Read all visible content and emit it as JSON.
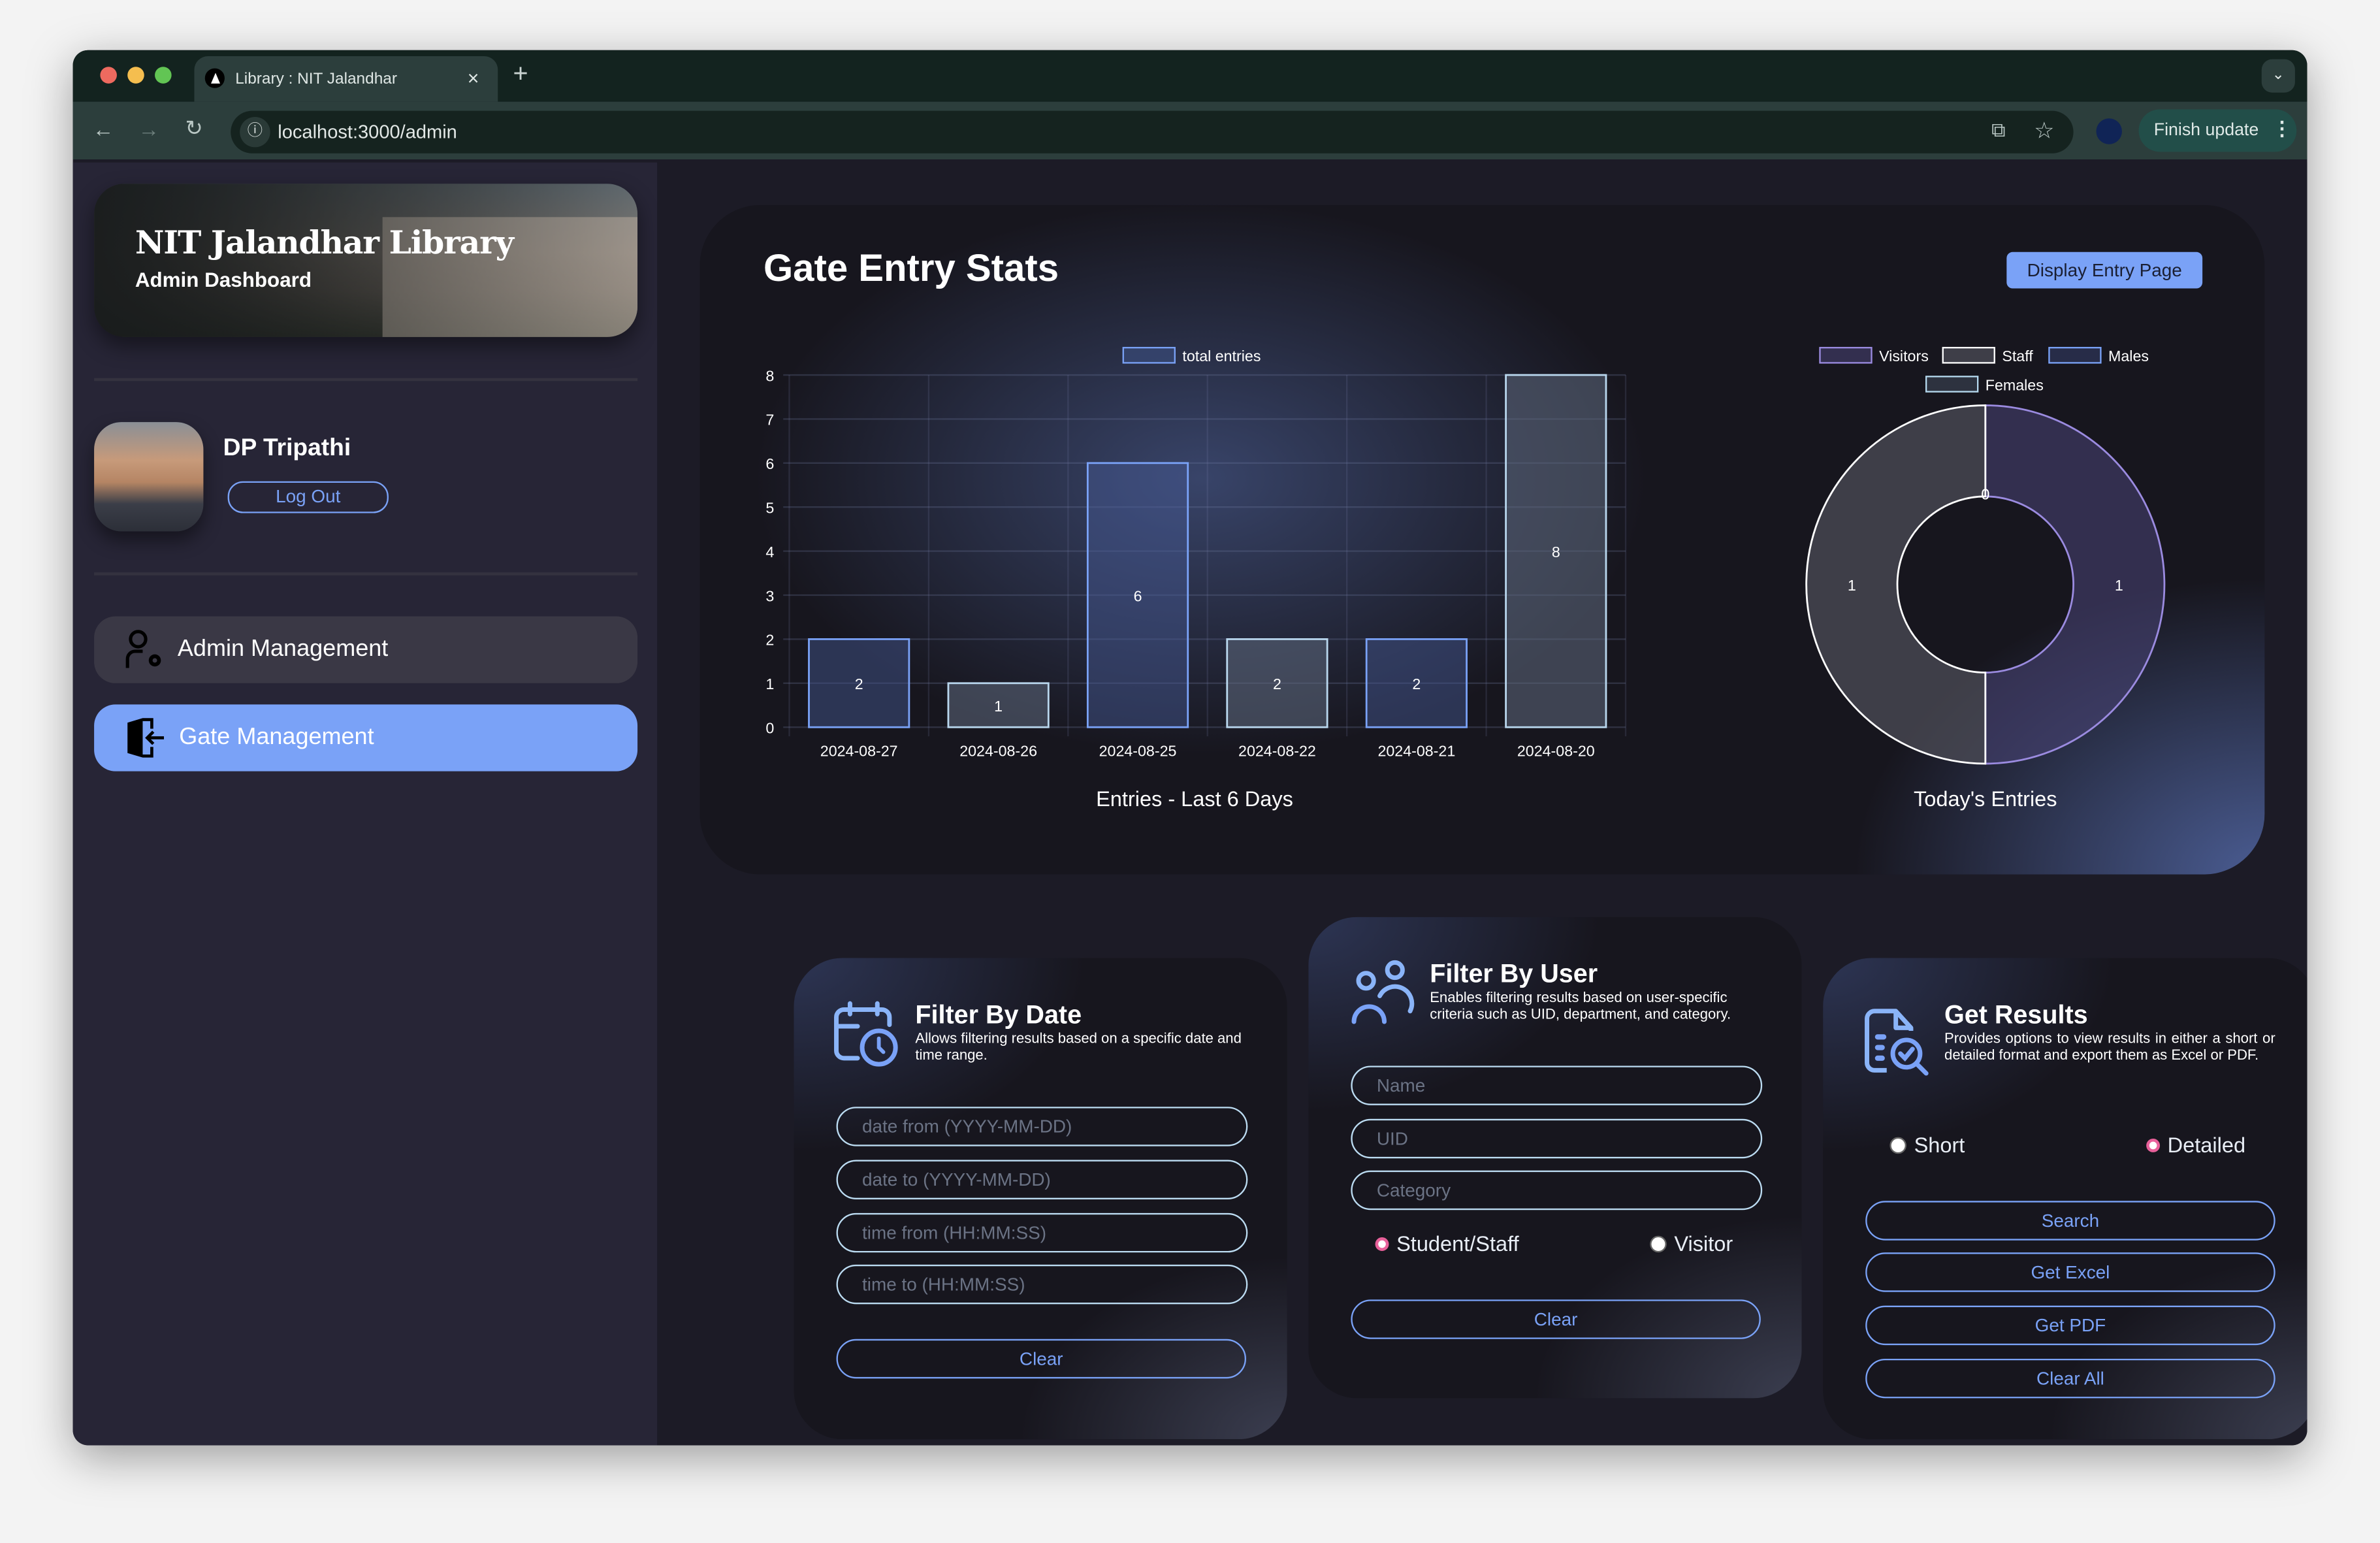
{
  "browser": {
    "tab_title": "Library : NIT Jalandhar",
    "url": "localhost:3000/admin",
    "finish_update": "Finish update"
  },
  "sidebar": {
    "title": "NIT Jalandhar Library",
    "subtitle": "Admin Dashboard",
    "user_name": "DP Tripathi",
    "logout": "Log Out",
    "nav": [
      {
        "label": "Admin Management",
        "icon": "user-gear-icon",
        "active": false
      },
      {
        "label": "Gate Management",
        "icon": "door-enter-icon",
        "active": true
      }
    ]
  },
  "stats": {
    "title": "Gate Entry Stats",
    "display_entry_button": "Display Entry Page"
  },
  "chart_data": [
    {
      "type": "bar",
      "title": "Entries - Last 6 Days",
      "legend": [
        "total entries"
      ],
      "categories": [
        "2024-08-27",
        "2024-08-26",
        "2024-08-25",
        "2024-08-22",
        "2024-08-21",
        "2024-08-20"
      ],
      "values": [
        2,
        1,
        6,
        2,
        2,
        8
      ],
      "yticks": [
        "0",
        "1",
        "2",
        "3",
        "4",
        "5",
        "6",
        "7",
        "8"
      ],
      "ylim": [
        0,
        8
      ],
      "grid": true,
      "legend_placement": "top"
    },
    {
      "type": "pie",
      "title": "Today's Entries",
      "labels": [
        "Visitors",
        "Staff",
        "Males",
        "Females"
      ],
      "values": [
        1,
        1,
        0,
        0
      ],
      "colors": [
        "#9b8be0",
        "#ffffff",
        "#7aa2f7",
        "#b4d8ee"
      ],
      "legend_placement": "top"
    }
  ],
  "filter_date": {
    "title": "Filter By Date",
    "description": "Allows filtering results based on a specific date and time range.",
    "placeholders": [
      "date from (YYYY-MM-DD)",
      "date to (YYYY-MM-DD)",
      "time from (HH:MM:SS)",
      "time to (HH:MM:SS)"
    ],
    "clear": "Clear"
  },
  "filter_user": {
    "title": "Filter By User",
    "description": "Enables filtering results based on user-specific criteria such as UID, department, and category.",
    "placeholders": [
      "Name",
      "UID",
      "Category"
    ],
    "radio_student": "Student/Staff",
    "radio_visitor": "Visitor",
    "selected": "Student/Staff",
    "clear": "Clear"
  },
  "results": {
    "title": "Get Results",
    "description": "Provides options to view results in either a short or detailed format and export them as Excel or PDF.",
    "radio_short": "Short",
    "radio_detailed": "Detailed",
    "selected": "Detailed",
    "buttons": [
      "Search",
      "Get Excel",
      "Get PDF",
      "Clear All"
    ]
  },
  "colors": {
    "accent": "#7aa2f7",
    "radio_selected": "#e8609a",
    "sidebar_bg": "#272536",
    "main_bg": "#1c1b26"
  }
}
